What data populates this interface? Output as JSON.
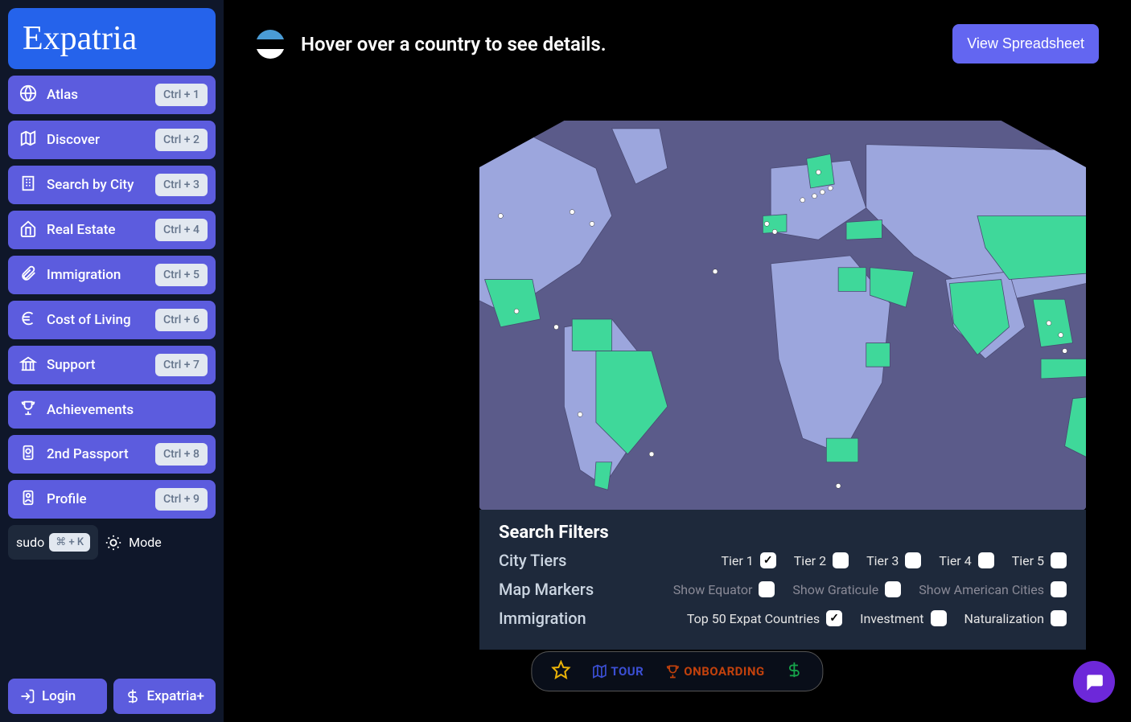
{
  "app_name": "Expatria",
  "sidebar": {
    "items": [
      {
        "label": "Atlas",
        "shortcut": "Ctrl + 1"
      },
      {
        "label": "Discover",
        "shortcut": "Ctrl + 2"
      },
      {
        "label": "Search by City",
        "shortcut": "Ctrl + 3"
      },
      {
        "label": "Real Estate",
        "shortcut": "Ctrl + 4"
      },
      {
        "label": "Immigration",
        "shortcut": "Ctrl + 5"
      },
      {
        "label": "Cost of Living",
        "shortcut": "Ctrl + 6"
      },
      {
        "label": "Support",
        "shortcut": "Ctrl + 7"
      },
      {
        "label": "Achievements",
        "shortcut": ""
      },
      {
        "label": "2nd Passport",
        "shortcut": "Ctrl + 8"
      },
      {
        "label": "Profile",
        "shortcut": "Ctrl + 9"
      }
    ],
    "sudo": {
      "label": "sudo",
      "shortcut": "⌘ + K"
    },
    "mode": "Mode",
    "login": "Login",
    "plus": "Expatria+"
  },
  "header": {
    "hover_text": "Hover over a country to see details.",
    "view_button": "View Spreadsheet"
  },
  "filters": {
    "title": "Search Filters",
    "rows": [
      {
        "label": "City Tiers",
        "options": [
          {
            "label": "Tier 1",
            "checked": true
          },
          {
            "label": "Tier 2",
            "checked": false
          },
          {
            "label": "Tier 3",
            "checked": false
          },
          {
            "label": "Tier 4",
            "checked": false
          },
          {
            "label": "Tier 5",
            "checked": false
          }
        ]
      },
      {
        "label": "Map Markers",
        "options": [
          {
            "label": "Show Equator",
            "checked": false,
            "dim": true
          },
          {
            "label": "Show Graticule",
            "checked": false,
            "dim": true
          },
          {
            "label": "Show American Cities",
            "checked": false,
            "dim": true
          }
        ]
      },
      {
        "label": "Immigration",
        "options": [
          {
            "label": "Top 50 Expat Countries",
            "checked": true
          },
          {
            "label": "Investment",
            "checked": false
          },
          {
            "label": "Naturalization",
            "checked": false
          }
        ]
      }
    ]
  },
  "floatbar": {
    "tour": "TOUR",
    "onboarding": "ONBOARDING"
  },
  "map": {
    "colors": {
      "ocean": "#5b5b8a",
      "land": "#9ca6dd",
      "highlight": "#3fd89a",
      "stroke": "#4a4a72"
    }
  }
}
